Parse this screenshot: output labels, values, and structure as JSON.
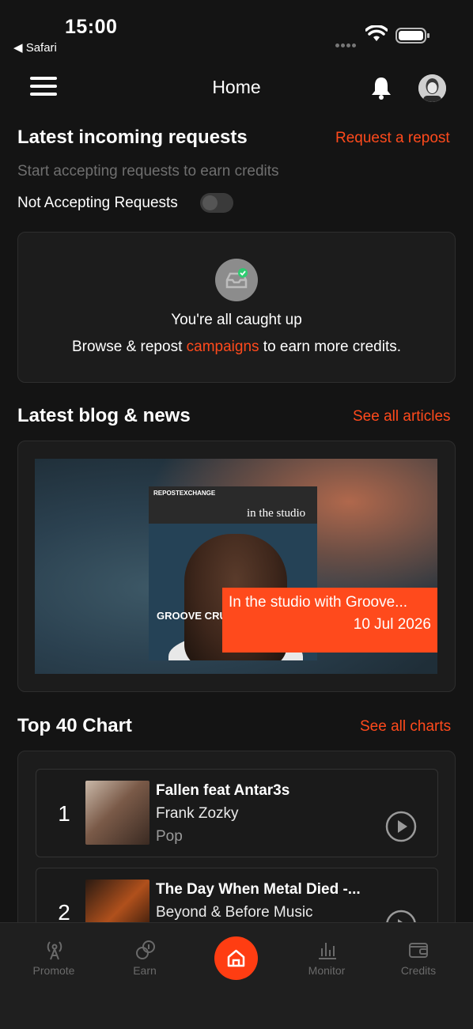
{
  "status_bar": {
    "time": "15:00",
    "back_app": "◀ Safari"
  },
  "header": {
    "title": "Home"
  },
  "requests": {
    "title": "Latest incoming requests",
    "link": "Request a repost",
    "subtitle": "Start accepting requests to earn credits",
    "toggle_label": "Not Accepting Requests",
    "empty_title": "You're all caught up",
    "empty_text_before": "Browse & repost ",
    "empty_text_link": "campaigns",
    "empty_text_after": " to earn more credits."
  },
  "blog": {
    "title": "Latest blog & news",
    "link": "See all articles",
    "cover_brand": "REPOSTEXCHANGE",
    "cover_tag": "in the studio",
    "cover_name": "GROOVE CRU",
    "article_title": "In the studio with Groove...",
    "article_date": "10 Jul 2026"
  },
  "chart": {
    "title": "Top 40 Chart",
    "link": "See all charts",
    "items": [
      {
        "rank": "1",
        "title": "Fallen feat Antar3s",
        "artist": "Frank Zozky",
        "genre": "Pop",
        "thumb_color": "#8a6a5a"
      },
      {
        "rank": "2",
        "title": "The Day When Metal Died -...",
        "artist": "Beyond & Before Music",
        "genre": "",
        "thumb_color": "#5a2a12"
      }
    ]
  },
  "tabs": [
    {
      "label": "Promote",
      "icon": "broadcast-icon"
    },
    {
      "label": "Earn",
      "icon": "coins-icon"
    },
    {
      "label": "",
      "icon": "home-icon"
    },
    {
      "label": "Monitor",
      "icon": "bar-chart-icon"
    },
    {
      "label": "Credits",
      "icon": "wallet-icon"
    }
  ],
  "colors": {
    "accent": "#ff4a1c",
    "background": "#141414"
  }
}
